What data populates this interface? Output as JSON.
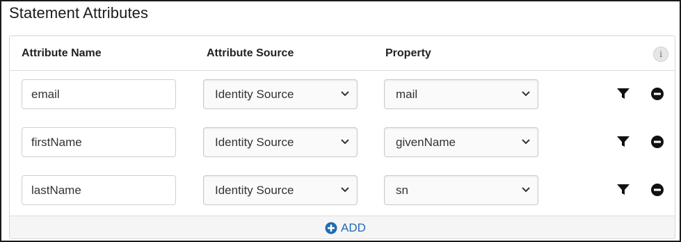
{
  "section": {
    "title": "Statement Attributes"
  },
  "table": {
    "columns": [
      "Attribute Name",
      "Attribute Source",
      "Property"
    ],
    "info_icon": "info-icon",
    "rows": [
      {
        "attribute_name": "email",
        "source": "Identity Source",
        "property": "mail"
      },
      {
        "attribute_name": "firstName",
        "source": "Identity Source",
        "property": "givenName"
      },
      {
        "attribute_name": "lastName",
        "source": "Identity Source",
        "property": "sn"
      }
    ],
    "row_icons": [
      "filter-icon",
      "remove-circle-icon"
    ]
  },
  "footer": {
    "add_label": "ADD",
    "add_icon": "plus-circle-icon"
  },
  "colors": {
    "accent": "#1f6bb3",
    "border": "#d6d6d6",
    "footer_bg": "#f5f5f5",
    "icon": "#111111"
  }
}
